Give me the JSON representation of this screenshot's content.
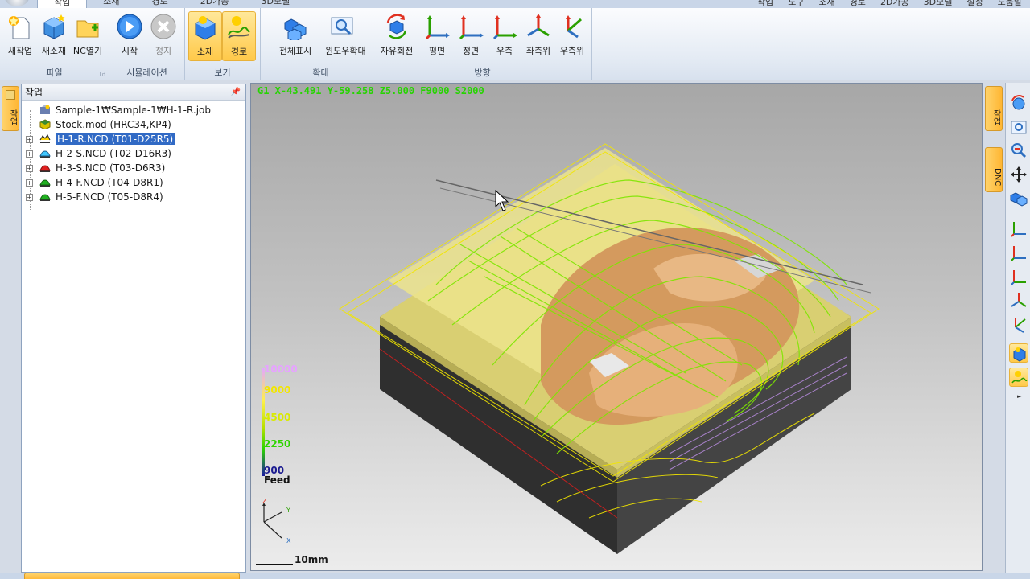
{
  "ribbon_tabs": [
    "작업",
    "소재",
    "경로",
    "2D가공",
    "3D모델"
  ],
  "menu_right": [
    "작업",
    "도구",
    "소재",
    "경로",
    "2D가공",
    "3D모델",
    "설정",
    "도움말"
  ],
  "ribbon": {
    "file_group": {
      "label": "파일",
      "buttons": [
        "새작업",
        "새소재",
        "NC열기"
      ]
    },
    "sim_group": {
      "label": "시뮬레이션",
      "buttons": [
        "시작",
        "정지"
      ]
    },
    "view_group": {
      "label": "보기",
      "buttons": [
        "소재",
        "경로"
      ]
    },
    "zoom_group": {
      "label": "확대",
      "buttons": [
        "전체표시",
        "윈도우확대"
      ]
    },
    "dir_group": {
      "label": "방향",
      "buttons": [
        "자유회전",
        "평면",
        "정면",
        "우측",
        "좌측위",
        "우측위"
      ]
    }
  },
  "left_panel": {
    "tab_label": "작업",
    "title": "작업",
    "tree": [
      {
        "text": "Sample-1₩Sample-1₩H-1-R.job",
        "icon": "job-icon",
        "expander": false
      },
      {
        "text": "Stock.mod (HRC34,KP4)",
        "icon": "stock-icon",
        "expander": false
      },
      {
        "text": "H-1-R.NCD (T01-D25R5)",
        "icon": "rough-path-icon",
        "expander": true,
        "selected": true
      },
      {
        "text": "H-2-S.NCD (T02-D16R3)",
        "icon": "semi-path-icon",
        "expander": true
      },
      {
        "text": "H-3-S.NCD (T03-D6R3)",
        "icon": "semi-path-icon",
        "expander": true
      },
      {
        "text": "H-4-F.NCD (T04-D8R1)",
        "icon": "finish-path-icon",
        "expander": true
      },
      {
        "text": "H-5-F.NCD (T05-D8R4)",
        "icon": "finish-path-icon",
        "expander": true
      }
    ]
  },
  "viewport": {
    "nc_readout": "G1 X-43.491 Y-59.258 Z5.000 F9000 S2000",
    "legend": {
      "values": [
        "10000",
        "9000",
        "4500",
        "2250",
        "900"
      ],
      "colors": [
        "#e6a3ff",
        "#f2e600",
        "#d8ea00",
        "#2ed400",
        "#1a1a90"
      ],
      "title": "Feed"
    },
    "axis": {
      "z": "Z",
      "y": "Y",
      "x": "X"
    },
    "scale": "10mm"
  },
  "right_tabs": [
    "작업",
    "DNC"
  ],
  "colors": {
    "accent": "#ffc94a",
    "toolpath": "#7ee600",
    "stock": "#e9e18a",
    "part": "#d79a5f"
  }
}
